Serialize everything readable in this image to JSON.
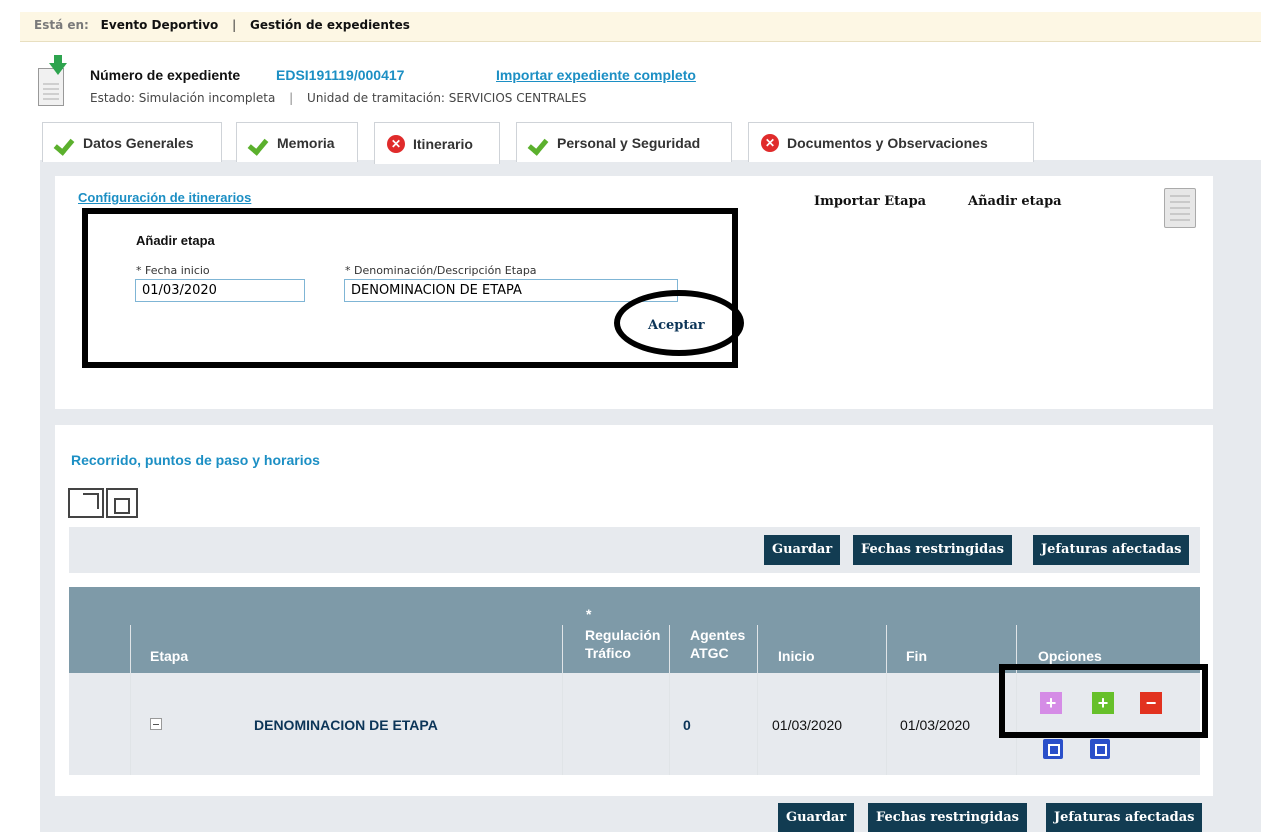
{
  "breadcrumb": {
    "label": "Está en:",
    "items": [
      "Evento Deportivo",
      "Gestión de expedientes"
    ]
  },
  "expediente": {
    "title_label": "Número de expediente",
    "number": "EDSI191119/000417",
    "import_link": "Importar expediente completo",
    "estado_label": "Estado:",
    "estado_value": "Simulación incompleta",
    "unidad_label": "Unidad de tramitación:",
    "unidad_value": "SERVICIOS CENTRALES"
  },
  "tabs": [
    {
      "label": "Datos Generales",
      "status": "ok"
    },
    {
      "label": "Memoria",
      "status": "ok"
    },
    {
      "label": "Itinerario",
      "status": "error"
    },
    {
      "label": "Personal y Seguridad",
      "status": "ok"
    },
    {
      "label": "Documentos y Observaciones",
      "status": "error"
    }
  ],
  "config": {
    "title": "Configuración de itinerarios",
    "import_stage": "Importar Etapa",
    "add_stage": "Añadir etapa"
  },
  "add_form": {
    "title": "Añadir etapa",
    "fecha_label": "* Fecha inicio",
    "fecha_value": "01/03/2020",
    "desc_label": "* Denominación/Descripción Etapa",
    "desc_value": "DENOMINACION DE ETAPA",
    "accept": "Aceptar"
  },
  "route": {
    "title": "Recorrido, puntos de paso y horarios",
    "buttons": {
      "save": "Guardar",
      "restricted": "Fechas restringidas",
      "jefaturas": "Jefaturas afectadas"
    }
  },
  "table": {
    "headers": {
      "etapa": "Etapa",
      "regulacion_mark": "*",
      "regulacion_1": "Regulación",
      "regulacion_2": "Tráfico",
      "agentes_1": "Agentes",
      "agentes_2": "ATGC",
      "inicio": "Inicio",
      "fin": "Fin",
      "opciones": "Opciones"
    },
    "rows": [
      {
        "etapa": "DENOMINACION DE ETAPA",
        "regulacion": "",
        "agentes": "0",
        "inicio": "01/03/2020",
        "fin": "01/03/2020"
      }
    ]
  },
  "colors": {
    "link": "#1c8fc4",
    "button": "#123c52",
    "table_header": "#7e9aa8",
    "ok": "#5bb02d",
    "error": "#e02b2b"
  }
}
